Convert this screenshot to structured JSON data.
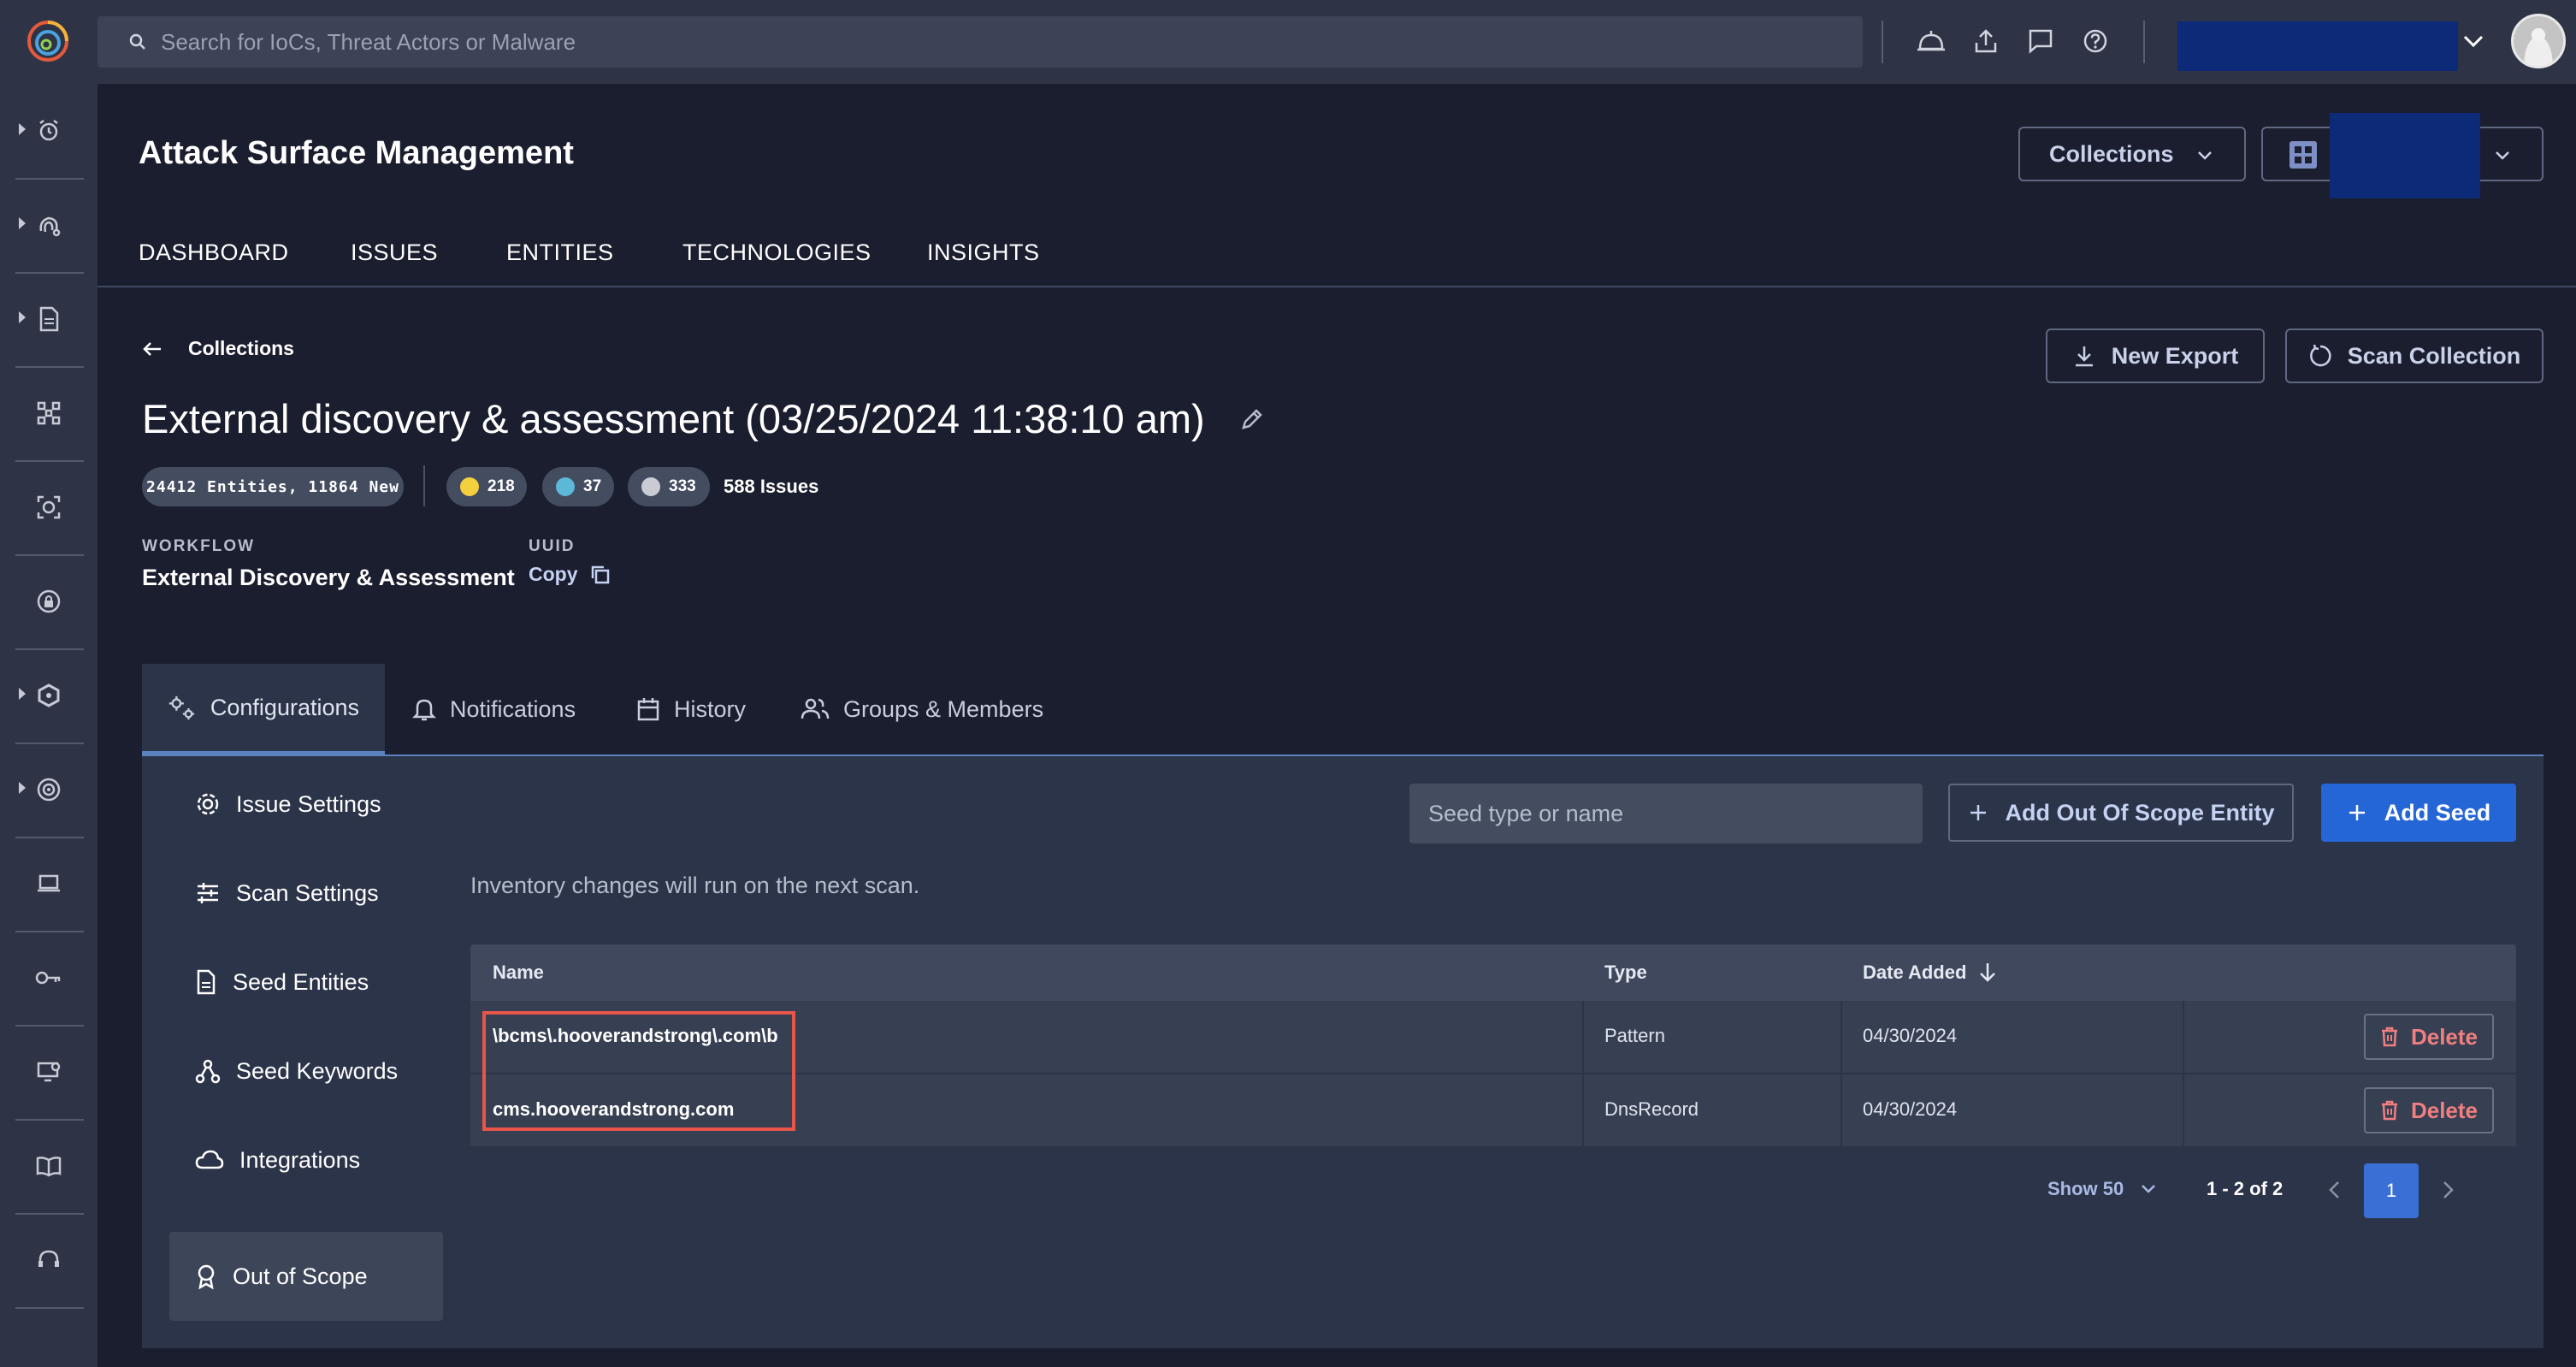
{
  "topbar": {
    "search_placeholder": "Search for IoCs, Threat Actors or Malware"
  },
  "header": {
    "title": "Attack Surface Management",
    "collections_label": "Collections"
  },
  "nav": {
    "tabs": [
      {
        "label": "DASHBOARD"
      },
      {
        "label": "ISSUES"
      },
      {
        "label": "ENTITIES"
      },
      {
        "label": "TECHNOLOGIES"
      },
      {
        "label": "INSIGHTS"
      }
    ]
  },
  "collection": {
    "back_label": "Collections",
    "title": "External discovery & assessment (03/25/2024 11:38:10 am)",
    "new_export_label": "New Export",
    "scan_collection_label": "Scan Collection",
    "entities_badge": "24412 Entities, 11864 New",
    "severity": [
      {
        "count": "218",
        "color": "#f4d03f"
      },
      {
        "count": "37",
        "color": "#5bb8d6"
      },
      {
        "count": "333",
        "color": "#c9ccd3"
      }
    ],
    "issues_label": "588 Issues",
    "workflow_label": "WORKFLOW",
    "workflow_value": "External Discovery & Assessment",
    "uuid_label": "UUID",
    "copy_label": "Copy"
  },
  "tabs": [
    {
      "label": "Configurations"
    },
    {
      "label": "Notifications"
    },
    {
      "label": "History"
    },
    {
      "label": "Groups & Members"
    }
  ],
  "settings_nav": [
    {
      "label": "Issue Settings"
    },
    {
      "label": "Scan Settings"
    },
    {
      "label": "Seed Entities"
    },
    {
      "label": "Seed Keywords"
    },
    {
      "label": "Integrations"
    },
    {
      "label": "Out of Scope"
    }
  ],
  "out_of_scope": {
    "seed_placeholder": "Seed type or name",
    "add_oos_label": "Add Out Of Scope Entity",
    "add_seed_label": "Add Seed",
    "note": "Inventory changes will run on the next scan.",
    "columns": {
      "name": "Name",
      "type": "Type",
      "date_added": "Date Added"
    },
    "rows": [
      {
        "name": "\\bcms\\.hooverandstrong\\.com\\b",
        "type": "Pattern",
        "date": "04/30/2024",
        "action": "Delete"
      },
      {
        "name": "cms.hooverandstrong.com",
        "type": "DnsRecord",
        "date": "04/30/2024",
        "action": "Delete"
      }
    ],
    "pagination": {
      "show_label": "Show 50",
      "range_label": "1 - 2 of 2",
      "current_page": "1"
    }
  },
  "colors": {
    "background": "#1b1e2f",
    "topbar": "#2e3445",
    "accent": "#2466d6",
    "danger": "#f07f7f",
    "highlight": "#e8564a"
  }
}
